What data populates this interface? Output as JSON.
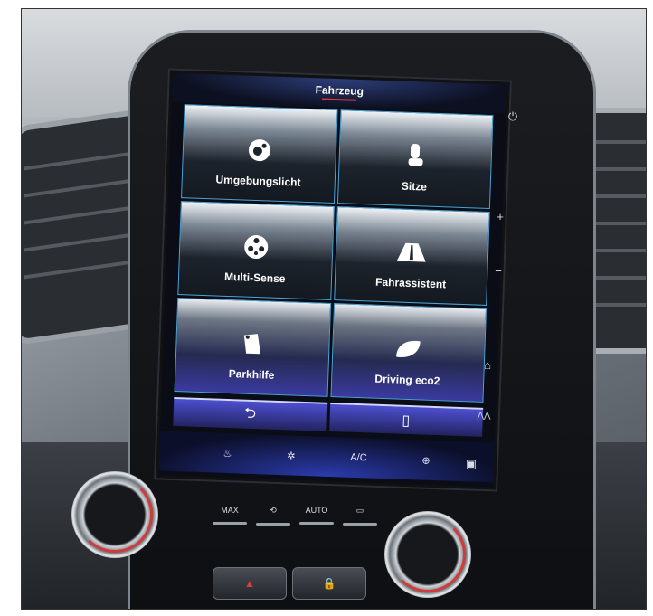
{
  "screen": {
    "title": "Fahrzeug",
    "tiles": [
      {
        "label": "Umgebungslicht",
        "icon": "ambient-light-icon"
      },
      {
        "label": "Sitze",
        "icon": "seat-icon"
      },
      {
        "label": "Multi-Sense",
        "icon": "multi-sense-icon"
      },
      {
        "label": "Fahrassistent",
        "icon": "road-icon"
      },
      {
        "label": "Parkhilfe",
        "icon": "parking-sensor-icon"
      },
      {
        "label": "Driving eco2",
        "icon": "eco-leaf-icon"
      }
    ],
    "nav": [
      {
        "icon": "back-arrow-icon",
        "glyph": "⮌"
      },
      {
        "icon": "trash-icon",
        "glyph": "▯"
      }
    ],
    "quick_bar": [
      {
        "icon": "seat-heat-icon",
        "glyph": "♨"
      },
      {
        "icon": "fan-icon",
        "glyph": "✲"
      },
      {
        "icon": "ac-label",
        "text": "A/C"
      },
      {
        "icon": "driver-assist-icon",
        "glyph": "⊕"
      }
    ]
  },
  "hard_keys": [
    {
      "name": "power-icon",
      "glyph": "⏻"
    },
    {
      "name": "volume-up-icon",
      "glyph": "+"
    },
    {
      "name": "volume-down-icon",
      "glyph": "−"
    },
    {
      "name": "home-icon",
      "glyph": "⌂"
    },
    {
      "name": "road-key-icon",
      "glyph": "⋀⋀"
    },
    {
      "name": "menu-icon",
      "glyph": "▣"
    }
  ],
  "climate": {
    "buttons": [
      {
        "name": "max-defrost-icon",
        "text": "MAX"
      },
      {
        "name": "recirculation-icon",
        "text": "⟲"
      },
      {
        "name": "auto-label",
        "text": "AUTO"
      },
      {
        "name": "rear-defrost-icon",
        "text": "▭"
      }
    ],
    "hazard": "▲",
    "lock": "🔒"
  },
  "colors": {
    "tile_border": "#4aa4d8",
    "accent_red": "#d63a3a",
    "screen_blue": "#2b3cb0"
  }
}
